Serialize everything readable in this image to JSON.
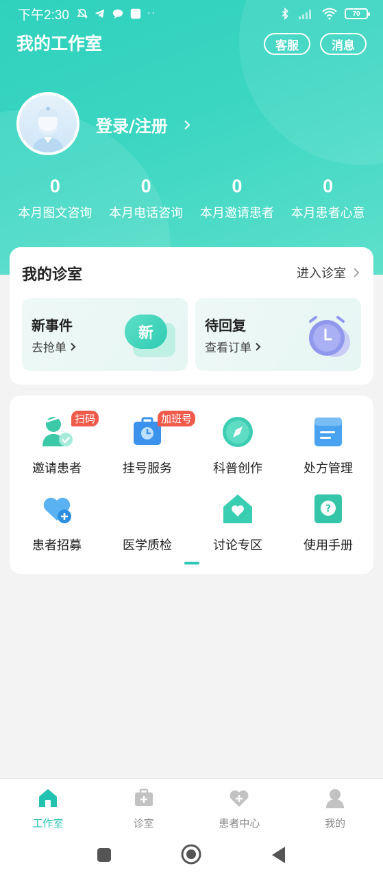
{
  "status_bar": {
    "time": "下午2:30",
    "battery": "70"
  },
  "header": {
    "title": "我的工作室",
    "service_label": "客服",
    "message_label": "消息"
  },
  "profile": {
    "login_label": "登录/注册"
  },
  "stats": [
    {
      "value": "0",
      "label": "本月图文咨询"
    },
    {
      "value": "0",
      "label": "本月电话咨询"
    },
    {
      "value": "0",
      "label": "本月邀请患者"
    },
    {
      "value": "0",
      "label": "本月患者心意"
    }
  ],
  "clinic": {
    "title": "我的诊室",
    "enter_label": "进入诊室",
    "new_event": {
      "title": "新事件",
      "link": "去抢单",
      "icon_text": "新"
    },
    "pending_reply": {
      "title": "待回复",
      "link": "查看订单"
    }
  },
  "grid": {
    "items": [
      {
        "label": "邀请患者",
        "icon": "invite-patient-icon",
        "tag": "扫码"
      },
      {
        "label": "挂号服务",
        "icon": "registration-icon",
        "tag": "加班号"
      },
      {
        "label": "科普创作",
        "icon": "compass-icon"
      },
      {
        "label": "处方管理",
        "icon": "prescription-icon"
      },
      {
        "label": "患者招募",
        "icon": "heart-plus-icon"
      },
      {
        "label": "医学质检",
        "icon": ""
      },
      {
        "label": "讨论专区",
        "icon": "house-heart-icon"
      },
      {
        "label": "使用手册",
        "icon": "help-icon"
      }
    ]
  },
  "tabbar": {
    "items": [
      {
        "label": "工作室",
        "active": true
      },
      {
        "label": "诊室",
        "active": false
      },
      {
        "label": "患者中心",
        "active": false
      },
      {
        "label": "我的",
        "active": false
      }
    ]
  },
  "colors": {
    "brand": "#2fd1bd",
    "tag": "#f05a4a",
    "active_tab": "#22c2b0"
  }
}
